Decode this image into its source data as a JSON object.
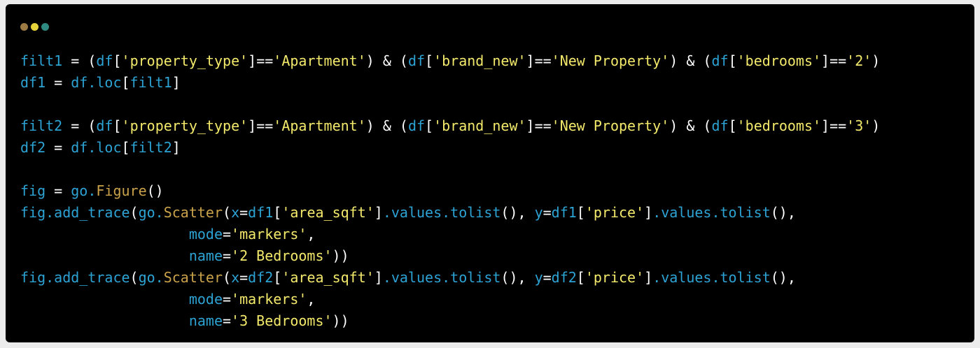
{
  "window": {
    "dots": [
      {
        "name": "close-dot",
        "color": "#9b7a43"
      },
      {
        "name": "minimize-dot",
        "color": "#e6d23a"
      },
      {
        "name": "zoom-dot",
        "color": "#2f8a82"
      }
    ]
  },
  "colors": {
    "background": "#000000",
    "variable": "#2da3d4",
    "string": "#f3e96b",
    "operator": "#ffffff",
    "function": "#c9a24a"
  },
  "code": {
    "lines": [
      [
        {
          "t": "var",
          "s": "filt1"
        },
        {
          "t": "op",
          "s": " = ("
        },
        {
          "t": "var",
          "s": "df"
        },
        {
          "t": "op",
          "s": "["
        },
        {
          "t": "str",
          "s": "'property_type'"
        },
        {
          "t": "op",
          "s": "]=="
        },
        {
          "t": "str",
          "s": "'Apartment'"
        },
        {
          "t": "op",
          "s": ") & ("
        },
        {
          "t": "var",
          "s": "df"
        },
        {
          "t": "op",
          "s": "["
        },
        {
          "t": "str",
          "s": "'brand_new'"
        },
        {
          "t": "op",
          "s": "]=="
        },
        {
          "t": "str",
          "s": "'New Property'"
        },
        {
          "t": "op",
          "s": ") & ("
        },
        {
          "t": "var",
          "s": "df"
        },
        {
          "t": "op",
          "s": "["
        },
        {
          "t": "str",
          "s": "'bedrooms'"
        },
        {
          "t": "op",
          "s": "]=="
        },
        {
          "t": "str",
          "s": "'2'"
        },
        {
          "t": "op",
          "s": ")"
        }
      ],
      [
        {
          "t": "var",
          "s": "df1"
        },
        {
          "t": "op",
          "s": " = "
        },
        {
          "t": "var",
          "s": "df.loc"
        },
        {
          "t": "op",
          "s": "["
        },
        {
          "t": "var",
          "s": "filt1"
        },
        {
          "t": "op",
          "s": "]"
        }
      ],
      [],
      [
        {
          "t": "var",
          "s": "filt2"
        },
        {
          "t": "op",
          "s": " = ("
        },
        {
          "t": "var",
          "s": "df"
        },
        {
          "t": "op",
          "s": "["
        },
        {
          "t": "str",
          "s": "'property_type'"
        },
        {
          "t": "op",
          "s": "]=="
        },
        {
          "t": "str",
          "s": "'Apartment'"
        },
        {
          "t": "op",
          "s": ") & ("
        },
        {
          "t": "var",
          "s": "df"
        },
        {
          "t": "op",
          "s": "["
        },
        {
          "t": "str",
          "s": "'brand_new'"
        },
        {
          "t": "op",
          "s": "]=="
        },
        {
          "t": "str",
          "s": "'New Property'"
        },
        {
          "t": "op",
          "s": ") & ("
        },
        {
          "t": "var",
          "s": "df"
        },
        {
          "t": "op",
          "s": "["
        },
        {
          "t": "str",
          "s": "'bedrooms'"
        },
        {
          "t": "op",
          "s": "]=="
        },
        {
          "t": "str",
          "s": "'3'"
        },
        {
          "t": "op",
          "s": ")"
        }
      ],
      [
        {
          "t": "var",
          "s": "df2"
        },
        {
          "t": "op",
          "s": " = "
        },
        {
          "t": "var",
          "s": "df.loc"
        },
        {
          "t": "op",
          "s": "["
        },
        {
          "t": "var",
          "s": "filt2"
        },
        {
          "t": "op",
          "s": "]"
        }
      ],
      [],
      [
        {
          "t": "var",
          "s": "fig"
        },
        {
          "t": "op",
          "s": " = "
        },
        {
          "t": "var",
          "s": "go."
        },
        {
          "t": "fn",
          "s": "Figure"
        },
        {
          "t": "op",
          "s": "()"
        }
      ],
      [
        {
          "t": "var",
          "s": "fig.add_trace"
        },
        {
          "t": "op",
          "s": "("
        },
        {
          "t": "var",
          "s": "go."
        },
        {
          "t": "fn",
          "s": "Scatter"
        },
        {
          "t": "op",
          "s": "("
        },
        {
          "t": "var",
          "s": "x"
        },
        {
          "t": "op",
          "s": "="
        },
        {
          "t": "var",
          "s": "df1"
        },
        {
          "t": "op",
          "s": "["
        },
        {
          "t": "str",
          "s": "'area_sqft'"
        },
        {
          "t": "op",
          "s": "]"
        },
        {
          "t": "var",
          "s": ".values.tolist"
        },
        {
          "t": "op",
          "s": "(), "
        },
        {
          "t": "var",
          "s": "y"
        },
        {
          "t": "op",
          "s": "="
        },
        {
          "t": "var",
          "s": "df1"
        },
        {
          "t": "op",
          "s": "["
        },
        {
          "t": "str",
          "s": "'price'"
        },
        {
          "t": "op",
          "s": "]"
        },
        {
          "t": "var",
          "s": ".values.tolist"
        },
        {
          "t": "op",
          "s": "(),"
        }
      ],
      [
        {
          "t": "op",
          "s": "                    "
        },
        {
          "t": "var",
          "s": "mode"
        },
        {
          "t": "op",
          "s": "="
        },
        {
          "t": "str",
          "s": "'markers'"
        },
        {
          "t": "op",
          "s": ","
        }
      ],
      [
        {
          "t": "op",
          "s": "                    "
        },
        {
          "t": "var",
          "s": "name"
        },
        {
          "t": "op",
          "s": "="
        },
        {
          "t": "str",
          "s": "'2 Bedrooms'"
        },
        {
          "t": "op",
          "s": "))"
        }
      ],
      [
        {
          "t": "var",
          "s": "fig.add_trace"
        },
        {
          "t": "op",
          "s": "("
        },
        {
          "t": "var",
          "s": "go."
        },
        {
          "t": "fn",
          "s": "Scatter"
        },
        {
          "t": "op",
          "s": "("
        },
        {
          "t": "var",
          "s": "x"
        },
        {
          "t": "op",
          "s": "="
        },
        {
          "t": "var",
          "s": "df2"
        },
        {
          "t": "op",
          "s": "["
        },
        {
          "t": "str",
          "s": "'area_sqft'"
        },
        {
          "t": "op",
          "s": "]"
        },
        {
          "t": "var",
          "s": ".values.tolist"
        },
        {
          "t": "op",
          "s": "(), "
        },
        {
          "t": "var",
          "s": "y"
        },
        {
          "t": "op",
          "s": "="
        },
        {
          "t": "var",
          "s": "df2"
        },
        {
          "t": "op",
          "s": "["
        },
        {
          "t": "str",
          "s": "'price'"
        },
        {
          "t": "op",
          "s": "]"
        },
        {
          "t": "var",
          "s": ".values.tolist"
        },
        {
          "t": "op",
          "s": "(),"
        }
      ],
      [
        {
          "t": "op",
          "s": "                    "
        },
        {
          "t": "var",
          "s": "mode"
        },
        {
          "t": "op",
          "s": "="
        },
        {
          "t": "str",
          "s": "'markers'"
        },
        {
          "t": "op",
          "s": ","
        }
      ],
      [
        {
          "t": "op",
          "s": "                    "
        },
        {
          "t": "var",
          "s": "name"
        },
        {
          "t": "op",
          "s": "="
        },
        {
          "t": "str",
          "s": "'3 Bedrooms'"
        },
        {
          "t": "op",
          "s": "))"
        }
      ]
    ]
  }
}
